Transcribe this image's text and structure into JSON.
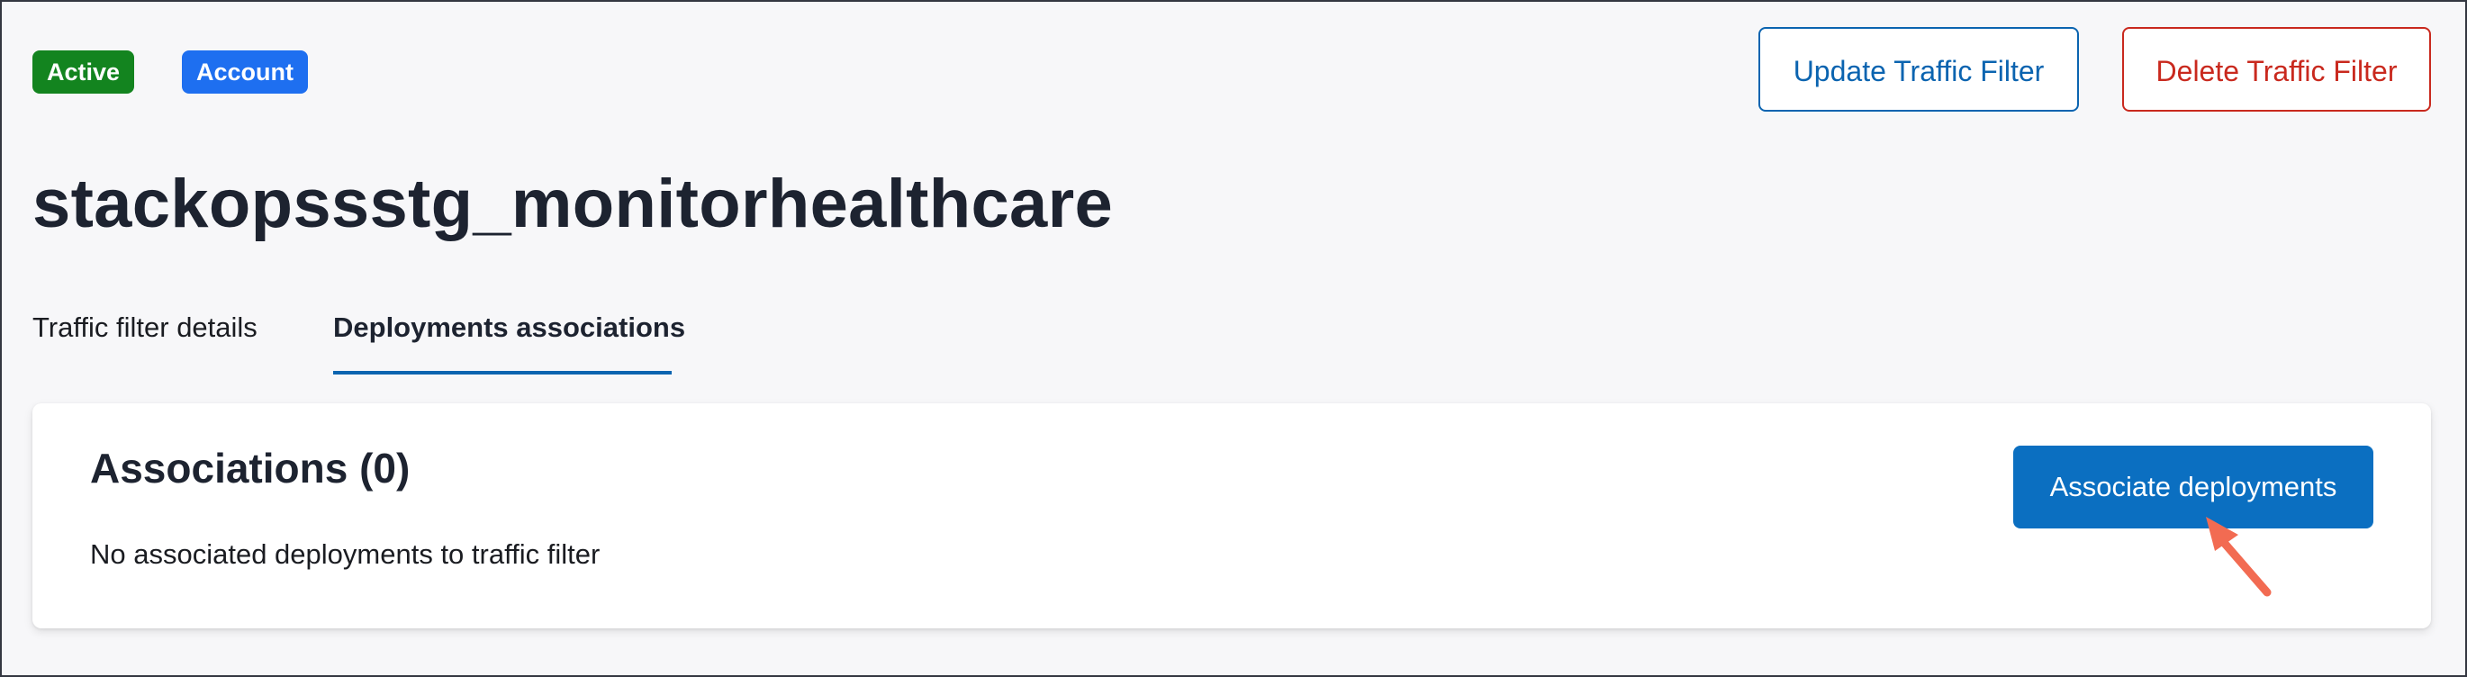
{
  "badges": {
    "status": "Active",
    "scope": "Account"
  },
  "actions": {
    "update": "Update Traffic Filter",
    "delete": "Delete Traffic Filter"
  },
  "page": {
    "title": "stackopssstg_monitorhealthcare"
  },
  "tabs": [
    {
      "label": "Traffic filter details",
      "selected": false
    },
    {
      "label": "Deployments associations",
      "selected": true
    }
  ],
  "associations": {
    "heading": "Associations (0)",
    "empty_text": "No associated deployments to traffic filter",
    "primary_action": "Associate deployments"
  },
  "colors": {
    "active_badge": "#13841f",
    "account_badge": "#1e6ff0",
    "primary": "#0b6fc1",
    "danger": "#c9291e",
    "annotation_arrow": "#f26b52"
  },
  "annotation": {
    "icon": "pointer-arrow-icon"
  }
}
